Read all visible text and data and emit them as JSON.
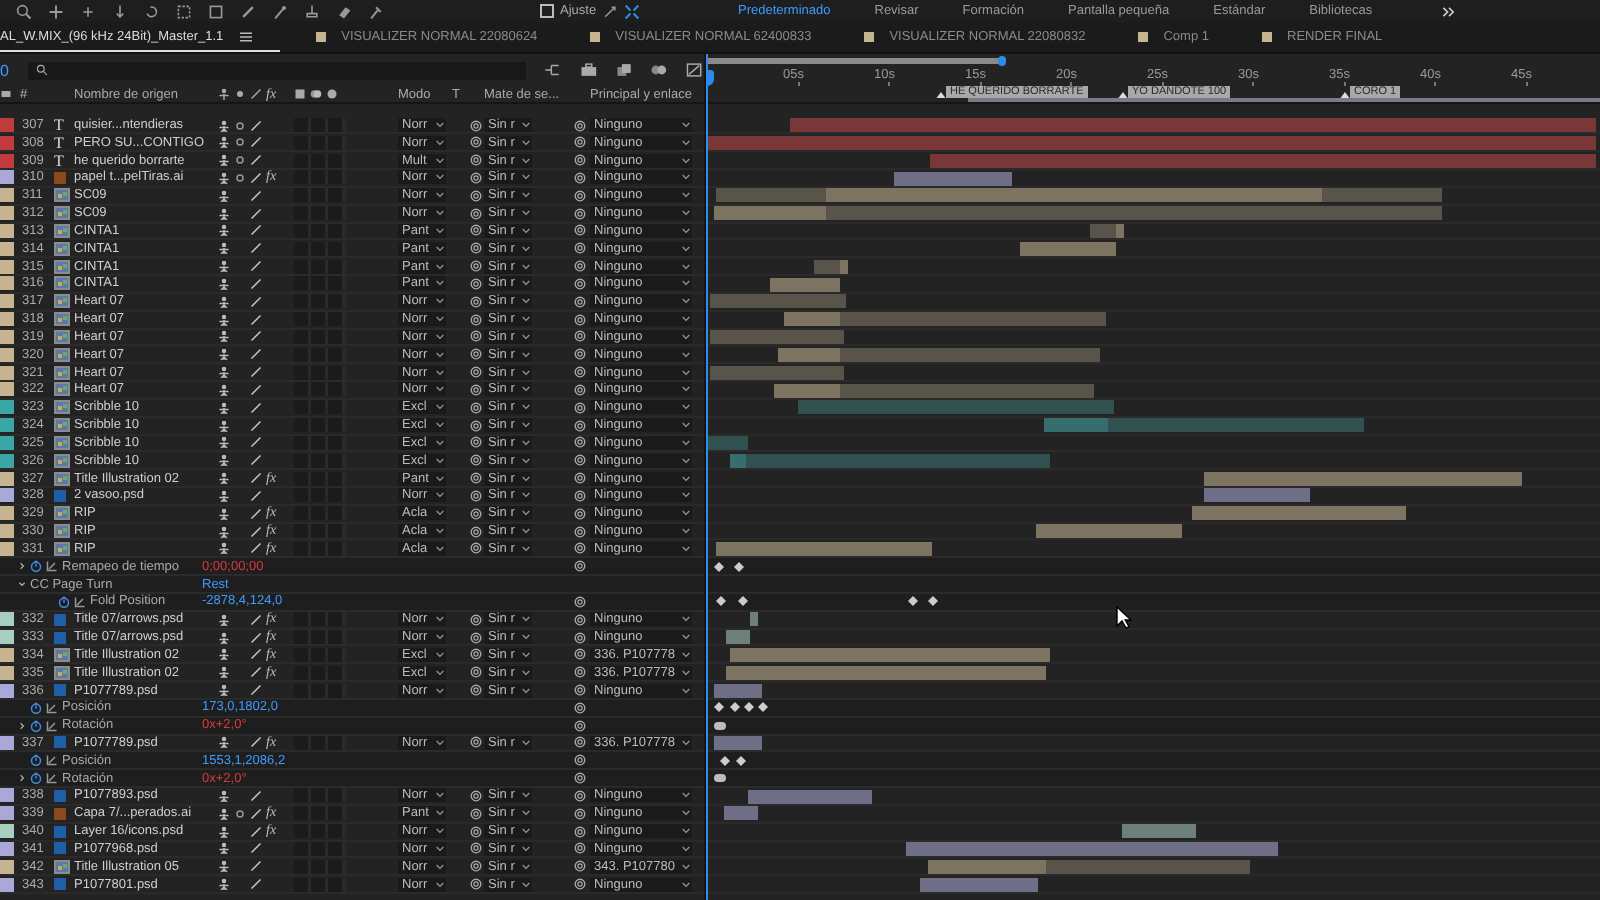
{
  "snap": {
    "label": "Ajuste",
    "checked": false
  },
  "workspaces": [
    {
      "label": "Predeterminado",
      "selected": true
    },
    {
      "label": "Revisar",
      "selected": false
    },
    {
      "label": "Formación",
      "selected": false
    },
    {
      "label": "Pantalla pequeña",
      "selected": false
    },
    {
      "label": "Estándar",
      "selected": false
    },
    {
      "label": "Bibliotecas",
      "selected": false
    }
  ],
  "comp_tabs": [
    {
      "label": "AL_W.MIX_(96 kHz 24Bit)_Master_1.1",
      "selected": true
    },
    {
      "label": "VISUALIZER NORMAL 22080624",
      "selected": false,
      "color": "#c5b48f"
    },
    {
      "label": "VISUALIZER NORMAL 62400833",
      "selected": false,
      "color": "#c5b48f"
    },
    {
      "label": "VISUALIZER NORMAL 22080832",
      "selected": false,
      "color": "#c5b48f"
    },
    {
      "label": "Comp 1",
      "selected": false,
      "color": "#c5b48f"
    },
    {
      "label": "RENDER FINAL",
      "selected": false,
      "color": "#c5b48f"
    }
  ],
  "timecode": "0",
  "columns": {
    "number": "#",
    "name": "Nombre de origen",
    "fx": "fx",
    "mode": "Modo",
    "t": "T",
    "matte": "Mate de se...",
    "parent": "Principal y enlace"
  },
  "ruler": {
    "ticks": [
      "05s",
      "10s",
      "15s",
      "20s",
      "25s",
      "30s",
      "35s",
      "40s",
      "45s"
    ],
    "markers": [
      {
        "label": "HE QUERIDO BORRARTE"
      },
      {
        "label": "YO DANDOTE 100"
      },
      {
        "label": "CORO 1"
      }
    ]
  },
  "rows": [
    {
      "number": "307",
      "kind": "text",
      "glyph": "T",
      "name": "quisier...ntendieras",
      "color": "#c03b3b",
      "collapse": true,
      "mode": "Norr",
      "matte": "Sin r",
      "parent": "Ninguno"
    },
    {
      "number": "308",
      "kind": "text",
      "glyph": "T",
      "name": "PERO SU...CONTIGO",
      "color": "#c03b3b",
      "collapse": true,
      "mode": "Norr",
      "matte": "Sin r",
      "parent": "Ninguno"
    },
    {
      "number": "309",
      "kind": "text",
      "glyph": "T",
      "name": "he querido borrarte",
      "color": "#c03b3b",
      "collapse": true,
      "mode": "Mult",
      "matte": "Sin r",
      "parent": "Ninguno"
    },
    {
      "number": "310",
      "kind": "ai",
      "name": "papel t...pelTiras.ai",
      "color": "#a9a8d8",
      "collapse": true,
      "fx": {
        "label": "fx",
        "on": true
      },
      "mode": "Norr",
      "matte": "Sin r",
      "parent": "Ninguno"
    },
    {
      "number": "311",
      "kind": "footage",
      "name": "SC09",
      "color": "#c5b48f",
      "collapse": false,
      "mode": "Norr",
      "matte": "Sin r",
      "parent": "Ninguno"
    },
    {
      "number": "312",
      "kind": "footage",
      "name": "SC09",
      "color": "#c5b48f",
      "collapse": false,
      "mode": "Norr",
      "matte": "Sin r",
      "parent": "Ninguno"
    },
    {
      "number": "313",
      "kind": "footage",
      "name": "CINTA1",
      "color": "#c5b48f",
      "collapse": false,
      "mode": "Pant",
      "matte": "Sin r",
      "parent": "Ninguno"
    },
    {
      "number": "314",
      "kind": "footage",
      "name": "CINTA1",
      "color": "#c5b48f",
      "collapse": false,
      "mode": "Pant",
      "matte": "Sin r",
      "parent": "Ninguno"
    },
    {
      "number": "315",
      "kind": "footage",
      "name": "CINTA1",
      "color": "#c5b48f",
      "collapse": false,
      "mode": "Pant",
      "matte": "Sin r",
      "parent": "Ninguno"
    },
    {
      "number": "316",
      "kind": "footage",
      "name": "CINTA1",
      "color": "#c5b48f",
      "collapse": false,
      "mode": "Pant",
      "matte": "Sin r",
      "parent": "Ninguno"
    },
    {
      "number": "317",
      "kind": "footage",
      "name": "Heart 07",
      "color": "#c5b48f",
      "collapse": false,
      "mode": "Norr",
      "matte": "Sin r",
      "parent": "Ninguno"
    },
    {
      "number": "318",
      "kind": "footage",
      "name": "Heart 07",
      "color": "#c5b48f",
      "collapse": false,
      "mode": "Norr",
      "matte": "Sin r",
      "parent": "Ninguno"
    },
    {
      "number": "319",
      "kind": "footage",
      "name": "Heart 07",
      "color": "#c5b48f",
      "collapse": false,
      "mode": "Norr",
      "matte": "Sin r",
      "parent": "Ninguno"
    },
    {
      "number": "320",
      "kind": "footage",
      "name": "Heart 07",
      "color": "#c5b48f",
      "collapse": false,
      "mode": "Norr",
      "matte": "Sin r",
      "parent": "Ninguno"
    },
    {
      "number": "321",
      "kind": "footage",
      "name": "Heart 07",
      "color": "#c5b48f",
      "collapse": false,
      "mode": "Norr",
      "matte": "Sin r",
      "parent": "Ninguno"
    },
    {
      "number": "322",
      "kind": "footage",
      "name": "Heart 07",
      "color": "#c5b48f",
      "collapse": false,
      "mode": "Norr",
      "matte": "Sin r",
      "parent": "Ninguno"
    },
    {
      "number": "323",
      "kind": "footage",
      "name": "Scribble 10",
      "color": "#3aa6a8",
      "collapse": false,
      "mode": "Excl",
      "matte": "Sin r",
      "parent": "Ninguno"
    },
    {
      "number": "324",
      "kind": "footage",
      "name": "Scribble 10",
      "color": "#3aa6a8",
      "collapse": false,
      "mode": "Excl",
      "matte": "Sin r",
      "parent": "Ninguno"
    },
    {
      "number": "325",
      "kind": "footage",
      "name": "Scribble 10",
      "color": "#3aa6a8",
      "collapse": false,
      "mode": "Excl",
      "matte": "Sin r",
      "parent": "Ninguno"
    },
    {
      "number": "326",
      "kind": "footage",
      "name": "Scribble 10",
      "color": "#3aa6a8",
      "collapse": false,
      "mode": "Excl",
      "matte": "Sin r",
      "parent": "Ninguno"
    },
    {
      "number": "327",
      "kind": "footage",
      "name": "Title Illustration 02",
      "color": "#c5b48f",
      "collapse": false,
      "fx": {
        "label": "fx",
        "on": true
      },
      "mode": "Pant",
      "matte": "Sin r",
      "parent": "Ninguno"
    },
    {
      "number": "328",
      "kind": "psd",
      "name": "2 vasoo.psd",
      "color": "#a9a8d8",
      "collapse": false,
      "mode": "Norr",
      "matte": "Sin r",
      "parent": "Ninguno"
    },
    {
      "number": "329",
      "kind": "footage",
      "name": "RIP",
      "color": "#c5b48f",
      "collapse": false,
      "fx": {
        "label": "fx",
        "on": true
      },
      "mode": "Acla",
      "matte": "Sin r",
      "parent": "Ninguno"
    },
    {
      "number": "330",
      "kind": "footage",
      "name": "RIP",
      "color": "#c5b48f",
      "collapse": false,
      "fx": {
        "label": "fx",
        "on": true
      },
      "mode": "Acla",
      "matte": "Sin r",
      "parent": "Ninguno"
    },
    {
      "number": "331",
      "kind": "footage",
      "name": "RIP",
      "color": "#c5b48f",
      "collapse": false,
      "fx": {
        "label": "fx",
        "on": true
      },
      "mode": "Acla",
      "matte": "Sin r",
      "parent": "Ninguno",
      "properties": [
        {
          "kind": "property",
          "name": "Remapeo de tiempo",
          "value": "0;00;00;00",
          "expression": true,
          "expanded": false
        },
        {
          "kind": "effect",
          "name": "CC Page Turn",
          "value": "Rest",
          "expanded": true,
          "children": [
            {
              "kind": "property",
              "name": "Fold Position",
              "value": "-2878,4,124,0",
              "expression": false
            }
          ]
        }
      ]
    },
    {
      "number": "332",
      "kind": "psd",
      "name": "Title 07/arrows.psd",
      "color": "#a6cfc0",
      "collapse": false,
      "fx": {
        "label": "fx",
        "on": true
      },
      "mode": "Norr",
      "matte": "Sin r",
      "parent": "Ninguno"
    },
    {
      "number": "333",
      "kind": "psd",
      "name": "Title 07/arrows.psd",
      "color": "#a6cfc0",
      "collapse": false,
      "fx": {
        "label": "fx",
        "on": true
      },
      "mode": "Norr",
      "matte": "Sin r",
      "parent": "Ninguno"
    },
    {
      "number": "334",
      "kind": "footage",
      "name": "Title Illustration 02",
      "color": "#c5b48f",
      "collapse": false,
      "fx": {
        "label": "fx",
        "on": true
      },
      "mode": "Excl",
      "matte": "Sin r",
      "parent": "336. P107778"
    },
    {
      "number": "335",
      "kind": "footage",
      "name": "Title Illustration 02",
      "color": "#c5b48f",
      "collapse": false,
      "fx": {
        "label": "fx",
        "on": true
      },
      "mode": "Excl",
      "matte": "Sin r",
      "parent": "336. P107778"
    },
    {
      "number": "336",
      "kind": "psd",
      "name": "P1077789.psd",
      "color": "#a9a8d8",
      "collapse": false,
      "mode": "Norr",
      "matte": "Sin r",
      "parent": "Ninguno",
      "properties": [
        {
          "kind": "property",
          "name": "Posición",
          "value": "173,0,1802,0",
          "expression": false
        },
        {
          "kind": "property",
          "name": "Rotación",
          "value": "0x+2,0°",
          "expression": true,
          "expanded": false
        }
      ]
    },
    {
      "number": "337",
      "kind": "psd",
      "name": "P1077789.psd",
      "color": "#a9a8d8",
      "collapse": false,
      "fx": {
        "label": "fx",
        "on": true
      },
      "mode": "Norr",
      "matte": "Sin r",
      "parent": "336. P107778",
      "properties": [
        {
          "kind": "property",
          "name": "Posición",
          "value": "1553,1,2086,2",
          "expression": false
        },
        {
          "kind": "property",
          "name": "Rotación",
          "value": "0x+2,0°",
          "expression": true,
          "expanded": false
        }
      ]
    },
    {
      "number": "338",
      "kind": "psd",
      "name": "P1077893.psd",
      "color": "#a9a8d8",
      "collapse": false,
      "mode": "Norr",
      "matte": "Sin r",
      "parent": "Ninguno"
    },
    {
      "number": "339",
      "kind": "ai",
      "name": "Capa 7/...perados.ai",
      "color": "#a9a8d8",
      "collapse": true,
      "fx": {
        "label": "fx",
        "on": true
      },
      "mode": "Pant",
      "matte": "Sin r",
      "parent": "Ninguno"
    },
    {
      "number": "340",
      "kind": "psd",
      "name": "Layer 16/icons.psd",
      "color": "#a6cfc0",
      "collapse": false,
      "fx": {
        "label": "fx",
        "on": true
      },
      "mode": "Norr",
      "matte": "Sin r",
      "parent": "Ninguno"
    },
    {
      "number": "341",
      "kind": "psd",
      "name": "P1077968.psd",
      "color": "#a9a8d8",
      "collapse": false,
      "mode": "Norr",
      "matte": "Sin r",
      "parent": "Ninguno"
    },
    {
      "number": "342",
      "kind": "footage",
      "name": "Title Illustration 05",
      "color": "#c5b48f",
      "collapse": false,
      "mode": "Norr",
      "matte": "Sin r",
      "parent": "343. P107780"
    },
    {
      "number": "343",
      "kind": "psd",
      "name": "P1077801.psd",
      "color": "#a9a8d8",
      "collapse": false,
      "mode": "Norr",
      "matte": "Sin r",
      "parent": "Ninguno"
    }
  ]
}
